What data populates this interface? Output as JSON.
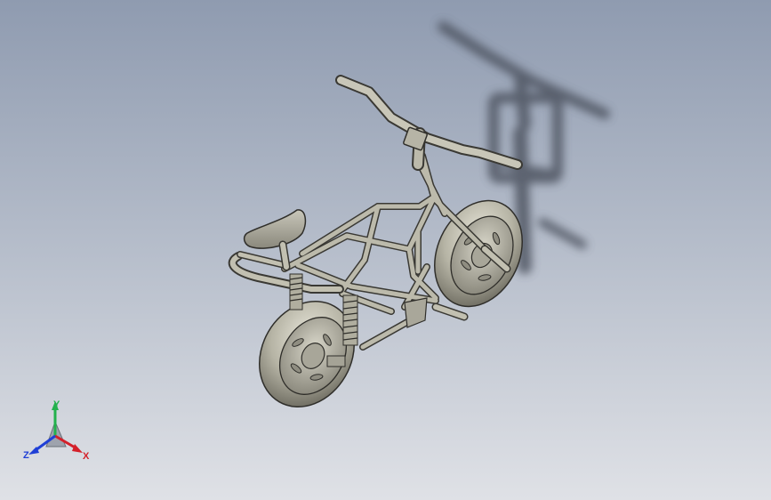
{
  "viewport": {
    "background_top": "#8f9bb0",
    "background_bottom": "#dfe1e6"
  },
  "model": {
    "icon": "bicycle-3d-model",
    "metal_color": "#b8b6a6",
    "shadow_color": "#4a4f5c"
  },
  "triad": {
    "x_label": "X",
    "y_label": "Y",
    "z_label": "Z",
    "x_color": "#d4202a",
    "y_color": "#22b14c",
    "z_color": "#1f3fd6"
  }
}
